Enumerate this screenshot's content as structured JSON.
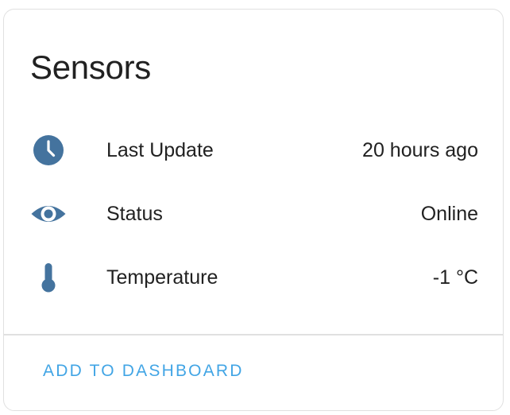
{
  "card": {
    "title": "Sensors",
    "rows": [
      {
        "icon": "clock-icon",
        "label": "Last Update",
        "value": "20 hours ago"
      },
      {
        "icon": "eye-icon",
        "label": "Status",
        "value": "Online"
      },
      {
        "icon": "thermometer-icon",
        "label": "Temperature",
        "value": "-1 °C"
      }
    ],
    "action_label": "ADD TO DASHBOARD"
  },
  "colors": {
    "icon": "#44739e",
    "accent": "#42a5e5",
    "text": "#212121",
    "border": "#e0e0e0"
  }
}
